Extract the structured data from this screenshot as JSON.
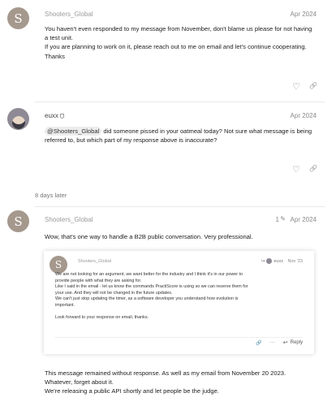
{
  "posts": [
    {
      "username": "Shooters_Global",
      "avatar_letter": "S",
      "date": "Apr 2024",
      "lines": [
        "You haven't even responded to my message from November, don't blame us please for not having",
        "a test unit.",
        "If you are planning to work on it, please reach out to me on email and let's continue cooperating.",
        "Thanks"
      ]
    },
    {
      "username": "euxx",
      "date": "Apr 2024",
      "mention": "@Shooters_Global",
      "line1_rest": " did someone pissed in your oatmeal today? Not sure what message is being",
      "line2": "referred to, but which part of my response above is inaccurate?"
    },
    {
      "username": "Shooters_Global",
      "avatar_letter": "S",
      "date": "Apr 2024",
      "edit_count": "1",
      "intro": "Wow, that's one way to handle a B2B public conversation. Very professional.",
      "quote": {
        "username": "Shooters_Global",
        "avatar_letter": "S",
        "reply_to": "euxx",
        "date": "Nov '23",
        "lines": [
          "We are not looking for an argument, we want better for the industry and I think it's in our power to",
          "provide people with what they are asking for.",
          "Like I said in the email - let us know the commands PractiScore is using so we can reserve them for",
          "your use. And they will not be changed in the future updates.",
          "We can't just stop updating the timer, as a software developer you understand how evolution is",
          "important.",
          "",
          "Look forward to your response on email, thanks."
        ],
        "reply_label": "Reply",
        "more": "···"
      },
      "after_lines": [
        "This message remained without response. As well as my email from November 20 2023.",
        "Whatever, forget about it.",
        "We're releasing a public API shortly and let people be the judge."
      ]
    }
  ],
  "time_gap": "8 days later"
}
